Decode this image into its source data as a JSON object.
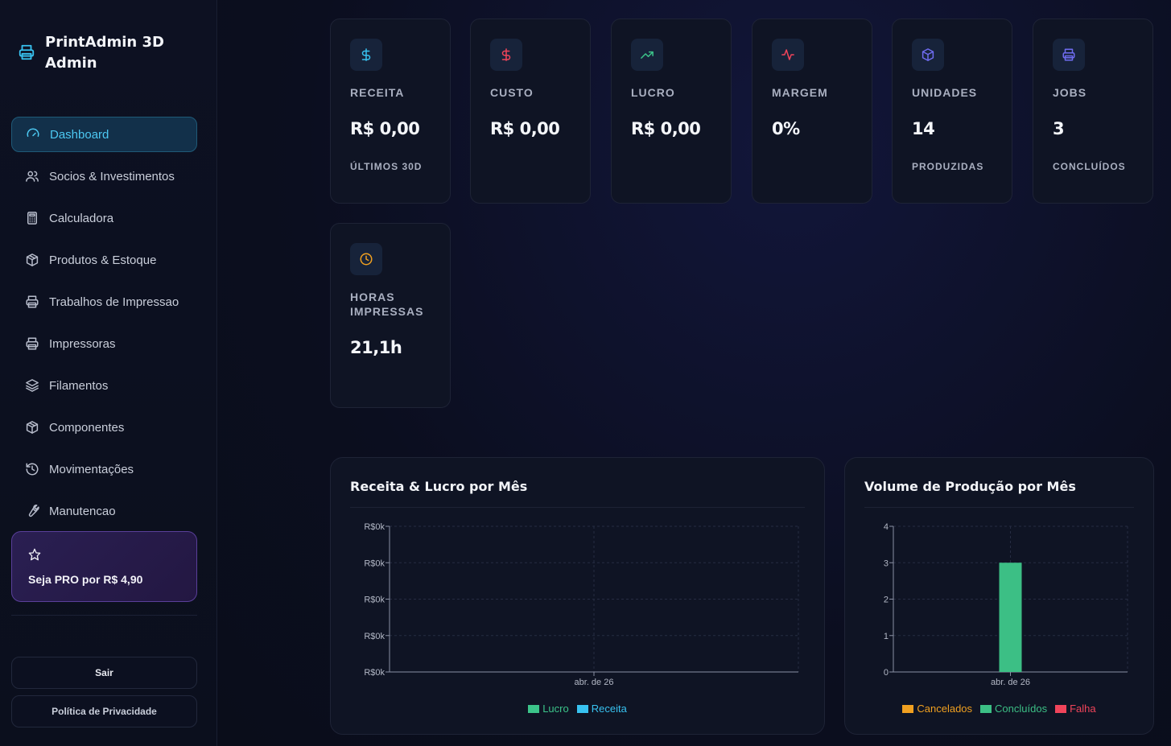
{
  "brand": {
    "title": "PrintAdmin 3D Admin"
  },
  "sidebar": {
    "items": [
      {
        "label": "Dashboard",
        "icon": "gauge-icon",
        "active": true
      },
      {
        "label": "Socios & Investimentos",
        "icon": "users-icon"
      },
      {
        "label": "Calculadora",
        "icon": "calculator-icon"
      },
      {
        "label": "Produtos & Estoque",
        "icon": "box-icon"
      },
      {
        "label": "Trabalhos de Impressao",
        "icon": "printer-icon"
      },
      {
        "label": "Impressoras",
        "icon": "printer-icon"
      },
      {
        "label": "Filamentos",
        "icon": "layers-icon"
      },
      {
        "label": "Componentes",
        "icon": "box-icon"
      },
      {
        "label": "Movimentações",
        "icon": "history-icon"
      },
      {
        "label": "Manutencao",
        "icon": "wrench-icon"
      }
    ],
    "pro_label": "Seja PRO por R$ 4,90",
    "logout_label": "Sair",
    "privacy_label": "Política de Privacidade"
  },
  "stats": [
    {
      "label": "RECEITA",
      "value": "R$ 0,00",
      "sub": "ÚLTIMOS 30D",
      "icon": "dollar-icon",
      "color": "#38c2f0"
    },
    {
      "label": "CUSTO",
      "value": "R$ 0,00",
      "sub": "",
      "icon": "dollar-icon",
      "color": "#f0445a"
    },
    {
      "label": "LUCRO",
      "value": "R$ 0,00",
      "sub": "",
      "icon": "trending-up-icon",
      "color": "#3cc48a"
    },
    {
      "label": "MARGEM",
      "value": "0%",
      "sub": "",
      "icon": "activity-icon",
      "color": "#f0445a"
    },
    {
      "label": "UNIDADES",
      "value": "14",
      "sub": "PRODUZIDAS",
      "icon": "cube-icon",
      "color": "#6f6cf0"
    },
    {
      "label": "JOBS",
      "value": "3",
      "sub": "CONCLUÍDOS",
      "icon": "printer-icon",
      "color": "#6f6cf0"
    },
    {
      "label": "HORAS IMPRESSAS",
      "value": "21,1h",
      "sub": "",
      "icon": "clock-icon",
      "color": "#f0a020"
    }
  ],
  "chart_data": [
    {
      "type": "line",
      "title": "Receita & Lucro por Mês",
      "categories": [
        "abr. de 26"
      ],
      "yticks": [
        "R$0k",
        "R$0k",
        "R$0k",
        "R$0k",
        "R$0k"
      ],
      "series": [
        {
          "name": "Lucro",
          "values": [
            0
          ],
          "color": "#3cc48a"
        },
        {
          "name": "Receita",
          "values": [
            0
          ],
          "color": "#38c2f0"
        }
      ],
      "grid": true,
      "legend": "bottom"
    },
    {
      "type": "bar",
      "title": "Volume de Produção por Mês",
      "categories": [
        "abr. de 26"
      ],
      "ylim": [
        0,
        4
      ],
      "yticks": [
        "0",
        "1",
        "2",
        "3",
        "4"
      ],
      "series": [
        {
          "name": "Cancelados",
          "values": [
            0
          ],
          "color": "#f0a020"
        },
        {
          "name": "Concluídos",
          "values": [
            3
          ],
          "color": "#3cbf85"
        },
        {
          "name": "Falha",
          "values": [
            0
          ],
          "color": "#f0445a"
        }
      ],
      "grid": true,
      "legend": "bottom"
    }
  ]
}
